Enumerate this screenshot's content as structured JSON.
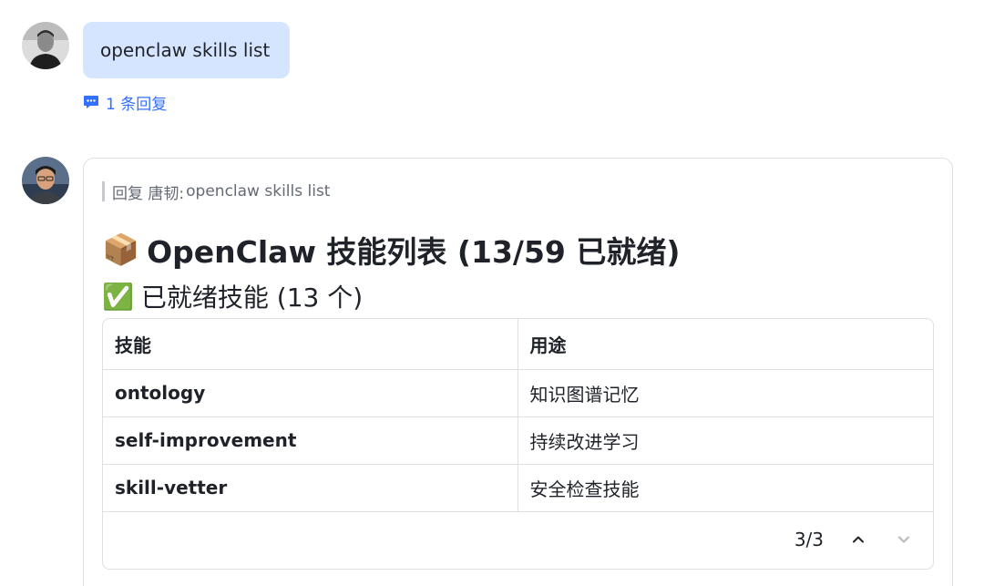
{
  "messages": [
    {
      "text": "openclaw skills list",
      "reply_count_label": "1 条回复"
    }
  ],
  "reply_card": {
    "quote_prefix": "回复 唐韧:",
    "quote_text": "openclaw skills list",
    "title_emoji": "📦",
    "title": "OpenClaw 技能列表 (13/59 已就绪)",
    "subtitle_emoji": "✅",
    "subtitle": "已就绪技能 (13 个)",
    "table": {
      "headers": [
        "技能",
        "用途"
      ],
      "rows": [
        {
          "skill": "ontology",
          "use": "知识图谱记忆"
        },
        {
          "skill": "self-improvement",
          "use": "持续改进学习"
        },
        {
          "skill": "skill-vetter",
          "use": "安全检查技能"
        }
      ]
    },
    "pager": {
      "label": "3/3"
    }
  },
  "colors": {
    "bubble_bg": "#d6e5ff",
    "link": "#3370ff",
    "border": "#dee0e3"
  },
  "icons": {
    "reply": "comment-bubble-icon",
    "prev": "chevron-up-icon",
    "next": "chevron-down-icon"
  }
}
